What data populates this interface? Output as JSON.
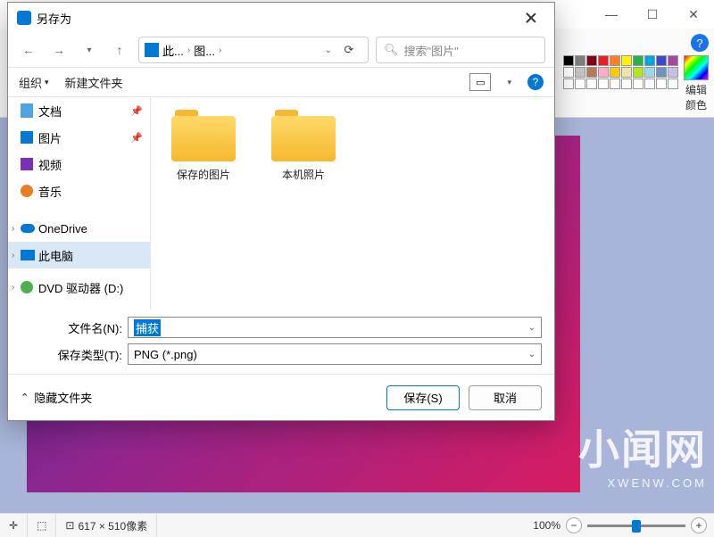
{
  "app": {
    "help_tooltip": "?",
    "ribbon": {
      "edit_color_line1": "编辑",
      "edit_color_line2": "颜色",
      "palette": [
        "#000000",
        "#7f7f7f",
        "#880015",
        "#ed1c24",
        "#ff7f27",
        "#fff200",
        "#22b14c",
        "#00a2e8",
        "#3f48cc",
        "#a349a4",
        "#ffffff",
        "#c3c3c3",
        "#b97a57",
        "#ffaec9",
        "#ffc90e",
        "#efe4b0",
        "#b5e61d",
        "#99d9ea",
        "#7092be",
        "#c8bfe7",
        "#ffffff",
        "#ffffff",
        "#ffffff",
        "#ffffff",
        "#ffffff",
        "#ffffff",
        "#ffffff",
        "#ffffff",
        "#ffffff",
        "#ffffff"
      ]
    }
  },
  "watermark": {
    "big": "小闻网",
    "small": "XWENW.COM"
  },
  "status": {
    "dims_icon": "⊡",
    "dims": "617 × 510像素",
    "zoom": "100%"
  },
  "dialog": {
    "title": "另存为",
    "nav": {
      "back": "←",
      "forward": "→",
      "up": "↑",
      "crumb1": "此...",
      "crumb2": "图...",
      "refresh": "⟳"
    },
    "search_placeholder": "搜索\"图片\"",
    "toolbar": {
      "organize": "组织",
      "new_folder": "新建文件夹"
    },
    "sidebar": [
      {
        "label": "文档",
        "pinned": true,
        "icon": "doc"
      },
      {
        "label": "图片",
        "pinned": true,
        "icon": "pic"
      },
      {
        "label": "视频",
        "pinned": false,
        "icon": "vid"
      },
      {
        "label": "音乐",
        "pinned": false,
        "icon": "mus"
      },
      {
        "label": "OneDrive",
        "expandable": true,
        "icon": "od"
      },
      {
        "label": "此电脑",
        "expandable": true,
        "selected": true,
        "icon": "pc"
      },
      {
        "label": "DVD 驱动器 (D:)",
        "expandable": true,
        "icon": "dvd"
      }
    ],
    "folders": [
      {
        "label": "保存的图片"
      },
      {
        "label": "本机照片"
      }
    ],
    "filename_label": "文件名(N):",
    "filename_value": "捕获",
    "filetype_label": "保存类型(T):",
    "filetype_value": "PNG (*.png)",
    "hide_folders": "隐藏文件夹",
    "save_btn": "保存(S)",
    "cancel_btn": "取消"
  }
}
